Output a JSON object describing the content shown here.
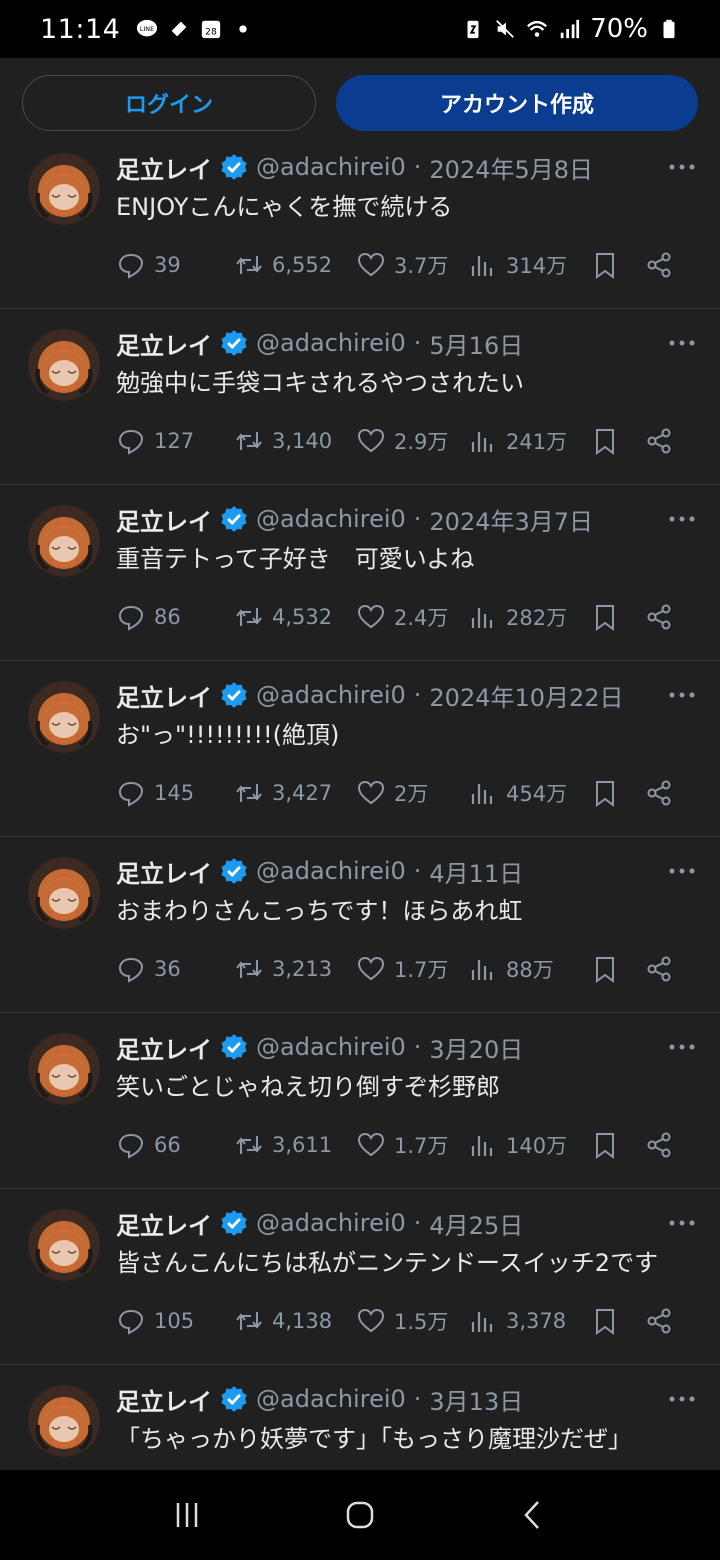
{
  "status_bar": {
    "time": "11:14",
    "battery": "70%",
    "left_icons": [
      "line-icon",
      "app-icon",
      "calendar-icon",
      "dot-icon"
    ],
    "calendar_day": "28",
    "right_icons": [
      "battery-saver-icon",
      "mute-icon",
      "wifi-icon",
      "signal-icon",
      "battery-icon"
    ]
  },
  "auth": {
    "login_label": "ログイン",
    "create_account_label": "アカウント作成"
  },
  "colors": {
    "background": "#202020",
    "accent": "#1d9bf0",
    "primary_button": "#0a3d8f",
    "muted_text": "#8b98a5"
  },
  "tweets": [
    {
      "name": "足立レイ",
      "handle": "@adachirei0",
      "date": "2024年5月8日",
      "text": "ENJOYこんにゃくを撫で続ける",
      "replies": "39",
      "retweets": "6,552",
      "likes": "3.7万",
      "views": "314万"
    },
    {
      "name": "足立レイ",
      "handle": "@adachirei0",
      "date": "5月16日",
      "text": "勉強中に手袋コキされるやつされたい",
      "replies": "127",
      "retweets": "3,140",
      "likes": "2.9万",
      "views": "241万"
    },
    {
      "name": "足立レイ",
      "handle": "@adachirei0",
      "date": "2024年3月7日",
      "text": "重音テトって子好き　可愛いよね",
      "replies": "86",
      "retweets": "4,532",
      "likes": "2.4万",
      "views": "282万"
    },
    {
      "name": "足立レイ",
      "handle": "@adachirei0",
      "date": "2024年10月22日",
      "text": "お\"っ\"!!!!!!!!!(絶頂)",
      "replies": "145",
      "retweets": "3,427",
      "likes": "2万",
      "views": "454万"
    },
    {
      "name": "足立レイ",
      "handle": "@adachirei0",
      "date": "4月11日",
      "text": "おまわりさんこっちです！ほらあれ虹",
      "replies": "36",
      "retweets": "3,213",
      "likes": "1.7万",
      "views": "88万"
    },
    {
      "name": "足立レイ",
      "handle": "@adachirei0",
      "date": "3月20日",
      "text": "笑いごとじゃねえ切り倒すぞ杉野郎",
      "replies": "66",
      "retweets": "3,611",
      "likes": "1.7万",
      "views": "140万"
    },
    {
      "name": "足立レイ",
      "handle": "@adachirei0",
      "date": "4月25日",
      "text": "皆さんこんにちは私がニンテンドースイッチ2です",
      "replies": "105",
      "retweets": "4,138",
      "likes": "1.5万",
      "views": "3,378"
    },
    {
      "name": "足立レイ",
      "handle": "@adachirei0",
      "date": "3月13日",
      "text": "「ちゃっかり妖夢です」「もっさり魔理沙だぜ」",
      "replies": "",
      "retweets": "",
      "likes": "",
      "views": ""
    }
  ],
  "nav": [
    "recent-apps-icon",
    "home-icon",
    "back-icon"
  ]
}
